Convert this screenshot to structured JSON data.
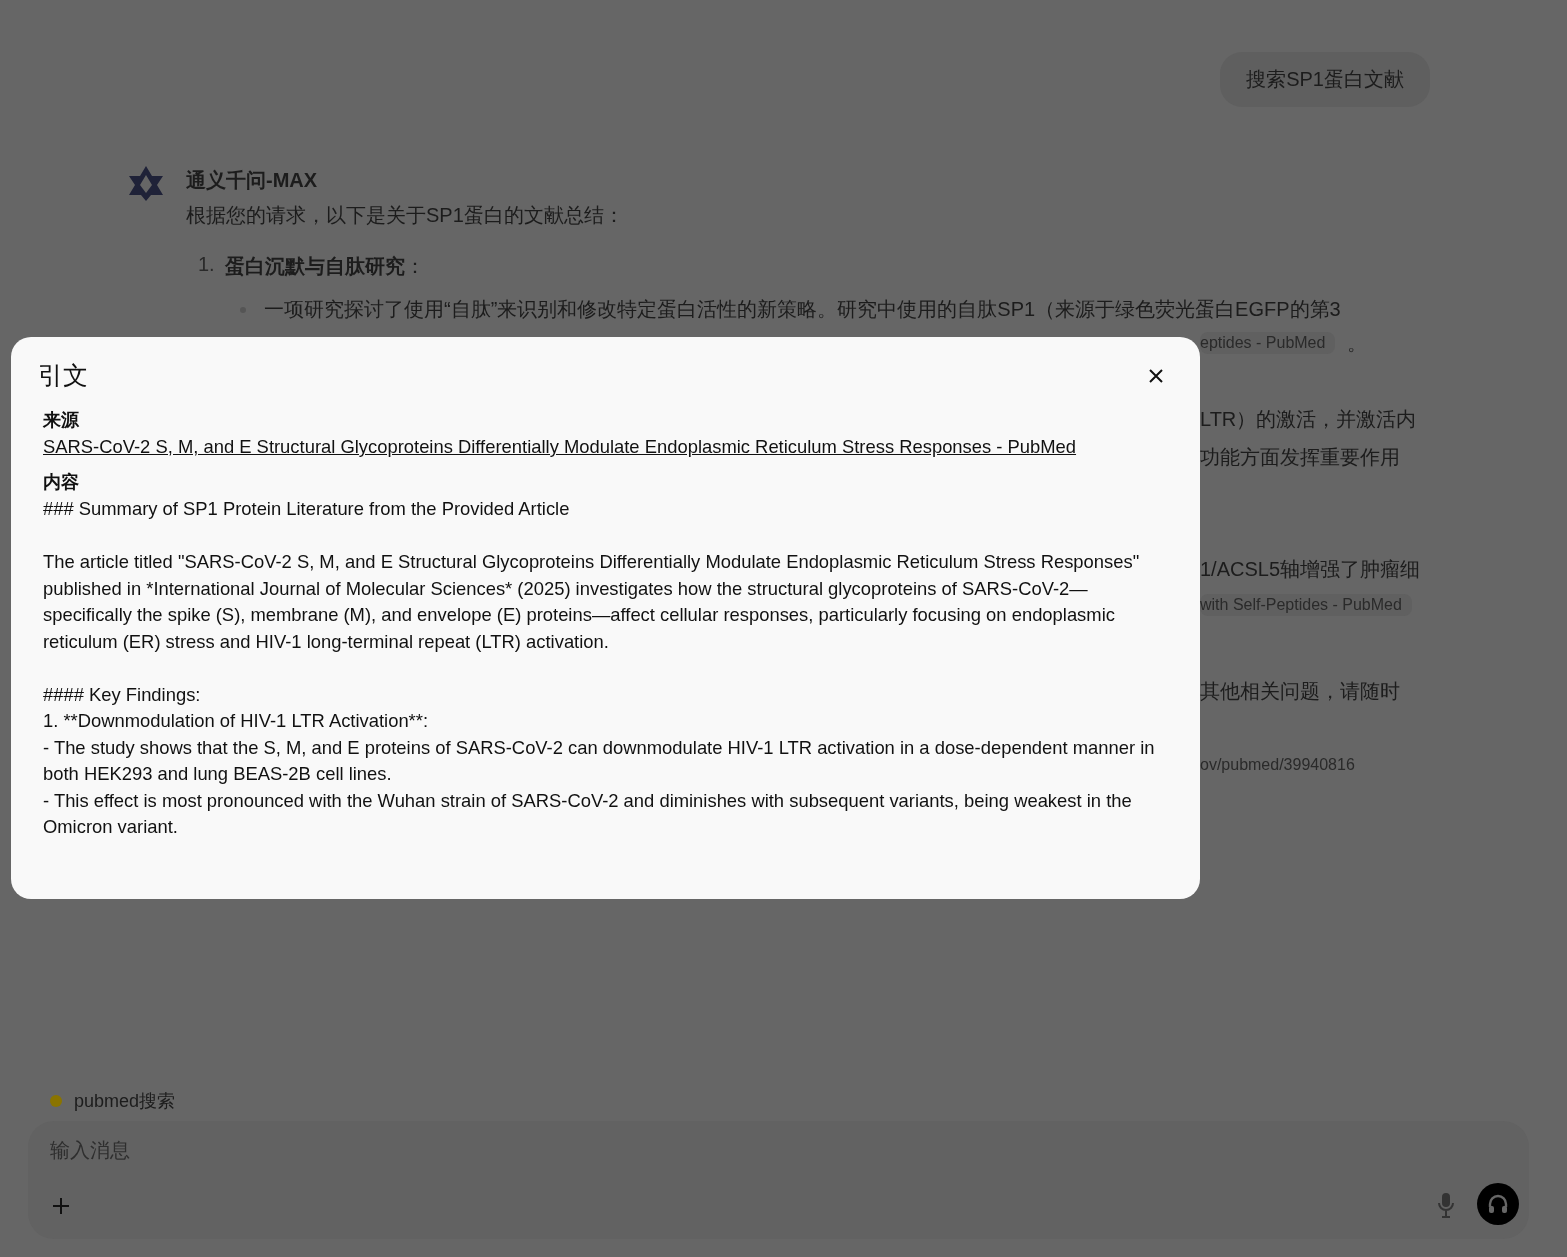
{
  "user_message": "搜索SP1蛋白文献",
  "assistant": {
    "name": "通义千问-MAX",
    "intro": "根据您的请求，以下是关于SP1蛋白的文献总结：",
    "items": [
      {
        "number": "1.",
        "title": "蛋白沉默与自肽研究",
        "suffix": "：",
        "bullet": "一项研究探讨了使用“自肽”来识别和修改特定蛋白活性的新策略。研究中使用的自肽SP1（来源于绿色荧光蛋白EGFP的第3"
      }
    ]
  },
  "obscured_rows": [
    {
      "parts": [
        {
          "kind": "chip",
          "text": "eptides - PubMed"
        },
        {
          "kind": "text",
          "text": "。"
        }
      ]
    },
    {
      "parts": [
        {
          "kind": "text",
          "text": "LTR）的激活，并激活内"
        }
      ]
    },
    {
      "parts": [
        {
          "kind": "text",
          "text": "功能方面发挥重要作用"
        }
      ]
    },
    {
      "parts": [
        {
          "kind": "text",
          "text": "1/ACSL5轴增强了肿瘤细"
        }
      ]
    },
    {
      "parts": [
        {
          "kind": "chip",
          "text": "with Self-Peptides - PubMed"
        }
      ]
    },
    {
      "parts": [
        {
          "kind": "text",
          "text": "其他相关问题，请随时"
        }
      ]
    },
    {
      "parts": [
        {
          "kind": "small",
          "text": "ov/pubmed/39940816"
        }
      ]
    }
  ],
  "tool_status": {
    "label": "pubmed搜索",
    "color": "#8a7400"
  },
  "composer": {
    "placeholder": "输入消息"
  },
  "citation_dialog": {
    "title": "引文",
    "source_label": "来源",
    "source_link": "SARS-CoV-2 S, M, and E Structural Glycoproteins Differentially Modulate Endoplasmic Reticulum Stress Responses - PubMed",
    "content_label": "内容",
    "content_blocks": [
      [
        "### Summary of SP1 Protein Literature from the Provided Article"
      ],
      [
        "The article titled \"SARS-CoV-2 S, M, and E Structural Glycoproteins Differentially Modulate Endoplasmic Reticulum Stress Responses\" published in *International Journal of Molecular Sciences* (2025) investigates how the structural glycoproteins of SARS-CoV-2—specifically the spike (S), membrane (M), and envelope (E) proteins—affect cellular responses, particularly focusing on endoplasmic reticulum (ER) stress and HIV-1 long-terminal repeat (LTR) activation."
      ],
      [
        "#### Key Findings:",
        "1. **Downmodulation of HIV-1 LTR Activation**:",
        "- The study shows that the S, M, and E proteins of SARS-CoV-2 can downmodulate HIV-1 LTR activation in a dose-dependent manner in both HEK293 and lung BEAS-2B cell lines.",
        "- This effect is most pronounced with the Wuhan strain of SARS-CoV-2 and diminishes with subsequent variants, being weakest in the Omicron variant."
      ]
    ]
  }
}
